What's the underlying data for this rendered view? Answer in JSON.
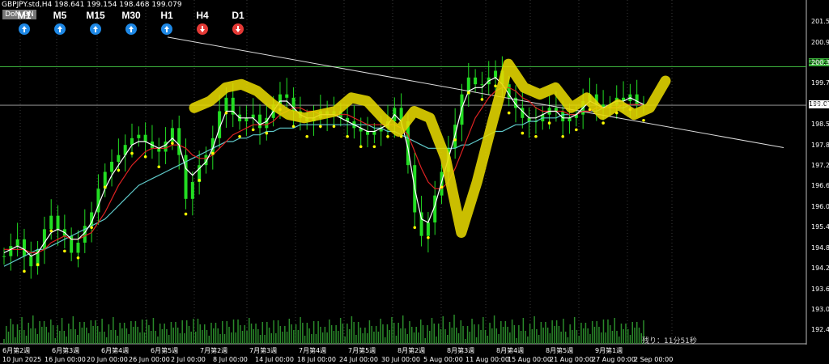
{
  "symbol_line": "GBPJPY.std,H4  198.641 199.154 198.468 199.079",
  "don_button": "DoN ON",
  "timeframes": [
    {
      "label": "M1",
      "dir": "up",
      "color": "#1e88e5"
    },
    {
      "label": "M5",
      "dir": "up",
      "color": "#1e88e5"
    },
    {
      "label": "M15",
      "dir": "up",
      "color": "#1e88e5"
    },
    {
      "label": "M30",
      "dir": "up",
      "color": "#1e88e5"
    },
    {
      "label": "H1",
      "dir": "up",
      "color": "#1e88e5"
    },
    {
      "label": "H4",
      "dir": "down",
      "color": "#e53935"
    },
    {
      "label": "D1",
      "dir": "down",
      "color": "#e53935"
    }
  ],
  "price_tags": {
    "level_green": "200.220",
    "current": "199.079"
  },
  "remaining_text": "残り：11分51秒",
  "colors": {
    "background": "#000000",
    "candles": "#22dd22",
    "ma_fast": "#ffffff",
    "ma_mid": "#dd2222",
    "ma_slow": "#5fc9c9",
    "volume": "#2a8a2a",
    "highlight": "#e6d800",
    "level_line": "#3cb03c"
  },
  "chart_data": {
    "type": "line",
    "title": "",
    "ylim": [
      192.0,
      202.2
    ],
    "y_ticks": [
      201.555,
      200.94,
      200.33,
      199.72,
      199.079,
      198.5,
      197.89,
      197.28,
      196.67,
      196.06,
      195.45,
      194.84,
      194.23,
      193.62,
      193.01,
      192.4
    ],
    "y_tick_labels": [
      "201.555",
      "200.940",
      "200.330",
      "199.720",
      "199.079",
      "198.500",
      "197.890",
      "197.280",
      "196.670",
      "196.060",
      "195.450",
      "194.840",
      "194.230",
      "193.620",
      "193.010",
      "192.400"
    ],
    "x_date_labels": [
      "10 Jun 2025",
      "16 Jun 00:00",
      "20 Jun 00:00",
      "26 Jun 00:00",
      "2 Jul 00:00",
      "8 Jul 00:00",
      "14 Jul 00:00",
      "18 Jul 00:00",
      "24 Jul 00:00",
      "30 Jul 00:00",
      "5 Aug 00:00",
      "11 Aug 00:00",
      "15 Aug 00:00",
      "21 Aug 00:00",
      "27 Aug 00:00",
      "2 Sep 00:00"
    ],
    "x_week_labels": [
      "6月第2週",
      "6月第3週",
      "6月第4週",
      "6月第5週",
      "7月第2週",
      "7月第3週",
      "7月第4週",
      "7月第5週",
      "8月第2週",
      "8月第3週",
      "8月第4週",
      "8月第5週",
      "9月第1週"
    ],
    "horizontal_level": 200.22,
    "current_price": 199.079,
    "trendline": {
      "start": 201.1,
      "end": 197.82
    },
    "series": [
      {
        "role": "price",
        "values": [
          194.6,
          194.9,
          195.1,
          194.6,
          194.3,
          194.8,
          195.4,
          195.8,
          195.4,
          195.2,
          194.7,
          195.0,
          195.5,
          195.9,
          196.6,
          197.1,
          197.4,
          197.6,
          197.9,
          198.1,
          198.2,
          198.0,
          197.8,
          197.7,
          198.0,
          198.4,
          197.6,
          196.3,
          196.8,
          197.3,
          197.6,
          198.1,
          198.9,
          199.3,
          198.8,
          198.6,
          198.7,
          198.8,
          198.4,
          198.7,
          199.1,
          199.4,
          199.3,
          198.9,
          198.7,
          198.6,
          198.7,
          198.9,
          198.8,
          198.9,
          198.7,
          198.6,
          198.4,
          198.3,
          198.2,
          198.3,
          198.4,
          198.6,
          199.0,
          198.6,
          197.3,
          195.9,
          195.2,
          195.6,
          196.4,
          197.1,
          197.8,
          198.5,
          199.4,
          199.9,
          199.7,
          199.7,
          199.9,
          200.1,
          199.7,
          199.3,
          199.0,
          198.7,
          198.6,
          198.6,
          198.8,
          199.0,
          198.9,
          198.6,
          198.7,
          198.8,
          199.2,
          199.4,
          199.1,
          199.0,
          199.1,
          199.3,
          199.2,
          199.4,
          199.1,
          199.079
        ]
      },
      {
        "role": "ma_fast",
        "values": [
          194.7,
          194.8,
          194.9,
          194.8,
          194.6,
          194.7,
          195.0,
          195.3,
          195.4,
          195.3,
          195.1,
          195.1,
          195.3,
          195.6,
          196.1,
          196.6,
          197.0,
          197.3,
          197.6,
          197.9,
          198.0,
          198.0,
          197.9,
          197.8,
          197.9,
          198.1,
          197.9,
          197.2,
          197.0,
          197.2,
          197.4,
          197.8,
          198.4,
          198.9,
          198.9,
          198.7,
          198.7,
          198.7,
          198.5,
          198.6,
          198.9,
          199.2,
          199.2,
          199.0,
          198.8,
          198.7,
          198.7,
          198.8,
          198.8,
          198.8,
          198.7,
          198.6,
          198.5,
          198.4,
          198.3,
          198.3,
          198.4,
          198.5,
          198.8,
          198.6,
          197.8,
          196.6,
          195.7,
          195.6,
          196.1,
          196.8,
          197.5,
          198.2,
          199.0,
          199.5,
          199.6,
          199.6,
          199.8,
          199.9,
          199.7,
          199.4,
          199.1,
          198.9,
          198.7,
          198.7,
          198.8,
          198.9,
          198.9,
          198.7,
          198.7,
          198.8,
          199.0,
          199.2,
          199.1,
          199.0,
          199.1,
          199.2,
          199.2,
          199.3,
          199.2,
          199.1
        ]
      },
      {
        "role": "ma_mid",
        "values": [
          194.8,
          194.8,
          194.8,
          194.8,
          194.7,
          194.7,
          194.8,
          195.0,
          195.1,
          195.2,
          195.1,
          195.1,
          195.2,
          195.3,
          195.6,
          195.9,
          196.3,
          196.7,
          197.0,
          197.3,
          197.5,
          197.7,
          197.8,
          197.8,
          197.8,
          197.9,
          197.9,
          197.8,
          197.6,
          197.5,
          197.5,
          197.6,
          197.8,
          198.0,
          198.2,
          198.3,
          198.4,
          198.5,
          198.5,
          198.5,
          198.6,
          198.8,
          198.9,
          199.0,
          199.0,
          198.9,
          198.9,
          198.8,
          198.8,
          198.8,
          198.8,
          198.8,
          198.7,
          198.6,
          198.5,
          198.5,
          198.5,
          198.5,
          198.5,
          198.4,
          198.2,
          197.7,
          197.2,
          196.8,
          196.6,
          196.6,
          196.8,
          197.2,
          197.7,
          198.2,
          198.7,
          199.0,
          199.3,
          199.5,
          199.6,
          199.6,
          199.5,
          199.3,
          199.2,
          199.0,
          198.9,
          198.9,
          198.9,
          198.9,
          198.8,
          198.8,
          198.9,
          198.9,
          199.0,
          199.0,
          199.0,
          199.0,
          199.1,
          199.1,
          199.1,
          199.1
        ]
      },
      {
        "role": "ma_slow",
        "values": [
          194.3,
          194.4,
          194.5,
          194.6,
          194.7,
          194.8,
          194.8,
          194.9,
          195.0,
          195.1,
          195.2,
          195.3,
          195.4,
          195.5,
          195.6,
          195.7,
          195.9,
          196.1,
          196.3,
          196.5,
          196.7,
          196.8,
          196.9,
          197.0,
          197.1,
          197.2,
          197.3,
          197.4,
          197.5,
          197.6,
          197.7,
          197.8,
          197.9,
          198.0,
          198.0,
          198.1,
          198.1,
          198.2,
          198.2,
          198.3,
          198.3,
          198.4,
          198.4,
          198.4,
          198.5,
          198.5,
          198.5,
          198.5,
          198.5,
          198.5,
          198.5,
          198.5,
          198.5,
          198.5,
          198.5,
          198.4,
          198.4,
          198.3,
          198.3,
          198.2,
          198.1,
          198.0,
          197.9,
          197.8,
          197.8,
          197.8,
          197.8,
          197.8,
          197.9,
          197.9,
          198.0,
          198.1,
          198.2,
          198.3,
          198.3,
          198.4,
          198.5,
          198.5,
          198.6,
          198.6,
          198.7,
          198.7,
          198.7,
          198.8,
          198.8,
          198.8,
          198.9,
          198.9,
          198.9,
          199.0,
          199.0,
          199.0,
          199.0,
          199.1,
          199.1,
          199.1
        ]
      },
      {
        "role": "highlight",
        "values": [
          199.0,
          199.2,
          199.6,
          199.7,
          199.5,
          199.1,
          198.8,
          198.7,
          198.8,
          198.9,
          199.3,
          199.2,
          198.7,
          198.3,
          198.9,
          198.7,
          197.5,
          195.3,
          196.8,
          198.6,
          200.3,
          199.6,
          199.4,
          199.6,
          199.0,
          199.3,
          198.8,
          199.1,
          198.8,
          199.0,
          199.8
        ]
      }
    ]
  }
}
